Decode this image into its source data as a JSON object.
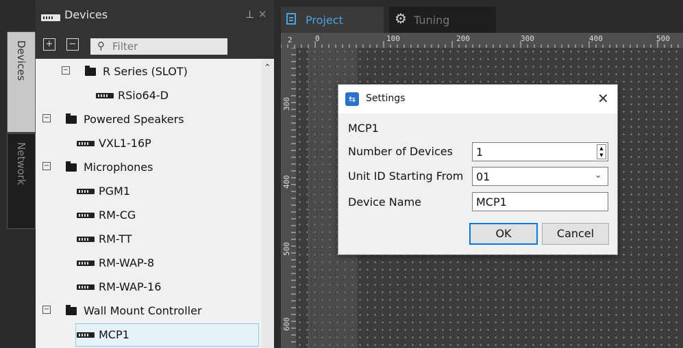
{
  "side_tabs": {
    "devices": "Devices",
    "network": "Network"
  },
  "devices_panel": {
    "title": "Devices",
    "expand_all": "+",
    "collapse_all": "−",
    "filter_placeholder": "Filter",
    "tree": [
      {
        "type": "folder",
        "label": "R Series (SLOT)",
        "expanded": true
      },
      {
        "type": "device",
        "label": "RSio64-D"
      },
      {
        "type": "folder",
        "label": "Powered Speakers",
        "expanded": true
      },
      {
        "type": "device",
        "label": "VXL1-16P"
      },
      {
        "type": "folder",
        "label": "Microphones",
        "expanded": true
      },
      {
        "type": "device",
        "label": "PGM1"
      },
      {
        "type": "device",
        "label": "RM-CG"
      },
      {
        "type": "device",
        "label": "RM-TT"
      },
      {
        "type": "device",
        "label": "RM-WAP-8"
      },
      {
        "type": "device",
        "label": "RM-WAP-16"
      },
      {
        "type": "folder",
        "label": "Wall Mount Controller",
        "expanded": true
      },
      {
        "type": "device",
        "label": "MCP1",
        "selected": true
      }
    ]
  },
  "tabs": [
    {
      "label": "Project",
      "active": true
    },
    {
      "label": "Tuning",
      "active": false
    }
  ],
  "ruler": {
    "top_labels": [
      "0",
      "100",
      "200",
      "300",
      "400",
      "500"
    ],
    "top_left_partial": "2",
    "left_labels": [
      "300",
      "400",
      "500",
      "600"
    ]
  },
  "dialog": {
    "title": "Settings",
    "device": "MCP1",
    "number_of_devices_label": "Number of Devices",
    "number_of_devices_value": "1",
    "unit_id_label": "Unit ID Starting From",
    "unit_id_value": "01",
    "device_name_label": "Device Name",
    "device_name_value": "MCP1",
    "ok_label": "OK",
    "cancel_label": "Cancel"
  },
  "colors": {
    "accent": "#4aa3df",
    "selection_bg": "#e6f2f8",
    "selection_border": "#8ecae6",
    "ok_border": "#0078d7",
    "dialog_icon": "#2a73c8"
  }
}
